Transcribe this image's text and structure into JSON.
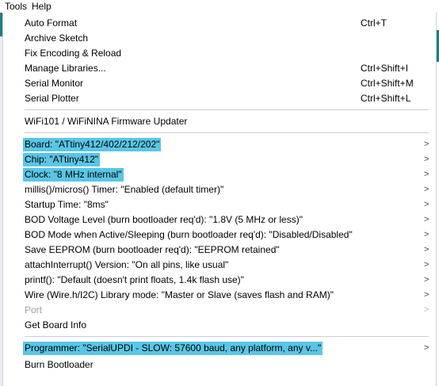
{
  "menubar": {
    "items": [
      "Tools",
      "Help"
    ]
  },
  "menu": {
    "items": [
      {
        "label": "Auto Format",
        "shortcut": "Ctrl+T"
      },
      {
        "label": "Archive Sketch",
        "shortcut": ""
      },
      {
        "label": "Fix Encoding & Reload",
        "shortcut": ""
      },
      {
        "label": "Manage Libraries...",
        "shortcut": "Ctrl+Shift+I"
      },
      {
        "label": "Serial Monitor",
        "shortcut": "Ctrl+Shift+M"
      },
      {
        "label": "Serial Plotter",
        "shortcut": "Ctrl+Shift+L"
      },
      {
        "label": "WiFi101 / WiFiNINA Firmware Updater",
        "shortcut": ""
      },
      {
        "label": "Board: \"ATtiny412/402/212/202\"",
        "submenu": true,
        "highlighted": true
      },
      {
        "label": "Chip: \"ATtiny412\"",
        "submenu": true,
        "highlighted": true
      },
      {
        "label": "Clock: \"8 MHz internal\"",
        "submenu": true,
        "highlighted": true
      },
      {
        "label": "millis()/micros() Timer: \"Enabled (default timer)\"",
        "submenu": true
      },
      {
        "label": "Startup Time: \"8ms\"",
        "submenu": true
      },
      {
        "label": "BOD Voltage Level (burn bootloader req'd): \"1.8V (5 MHz or less)\"",
        "submenu": true
      },
      {
        "label": "BOD Mode when Active/Sleeping (burn bootloader req'd): \"Disabled/Disabled\"",
        "submenu": true
      },
      {
        "label": "Save EEPROM (burn bootloader req'd): \"EEPROM retained\"",
        "submenu": true
      },
      {
        "label": "attachInterrupt() Version: \"On all pins, like usual\"",
        "submenu": true
      },
      {
        "label": "printf(): \"Default (doesn't print floats, 1.4k flash use)\"",
        "submenu": true
      },
      {
        "label": "Wire (Wire.h/I2C) Library mode: \"Master or Slave (saves flash and RAM)\"",
        "submenu": true
      },
      {
        "label": "Port",
        "submenu": true,
        "disabled": true
      },
      {
        "label": "Get Board Info"
      },
      {
        "label": "Programmer: \"SerialUPDI - SLOW: 57600 baud, any platform, any v...\"",
        "submenu": true,
        "highlighted": true
      },
      {
        "label": "Burn Bootloader"
      }
    ],
    "submenu_arrow": ">"
  }
}
